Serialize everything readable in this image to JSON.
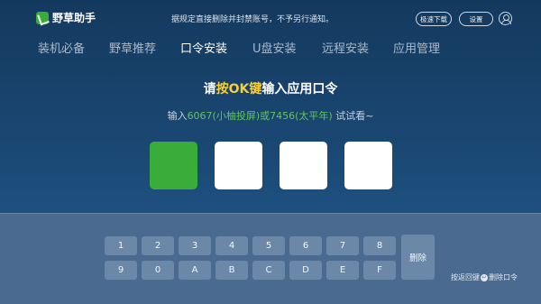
{
  "header": {
    "app_name": "野草助手",
    "notice": "据规定直接删除并封禁账号，不予另行通知。",
    "download_button": "极速下载",
    "settings_button": "设置",
    "user_icon": "user-icon"
  },
  "nav": {
    "items": [
      "装机必备",
      "野草推荐",
      "口令安装",
      "U盘安装",
      "远程安装",
      "应用管理"
    ],
    "active": "口令安装"
  },
  "main": {
    "title_prefix": "请",
    "title_highlight": "按OK键",
    "title_suffix": "输入应用口令",
    "hint_prefix": "输入",
    "hint_example": "6067(小柚投屏)或7456(太平年)",
    "hint_suffix": " 试试看~",
    "code_filled": 1,
    "code_length": 4
  },
  "keyboard": {
    "row1": [
      "1",
      "2",
      "3",
      "4",
      "5",
      "6",
      "7",
      "8"
    ],
    "row2": [
      "9",
      "0",
      "A",
      "B",
      "C",
      "D",
      "E",
      "F"
    ],
    "delete_label": "删除",
    "back_hint_prefix": "按返回键",
    "back_hint_suffix": "删除口令"
  },
  "colors": {
    "accent_green": "#3aac3a",
    "highlight_yellow": "#f5d03c",
    "hint_green": "#5fc55f"
  }
}
